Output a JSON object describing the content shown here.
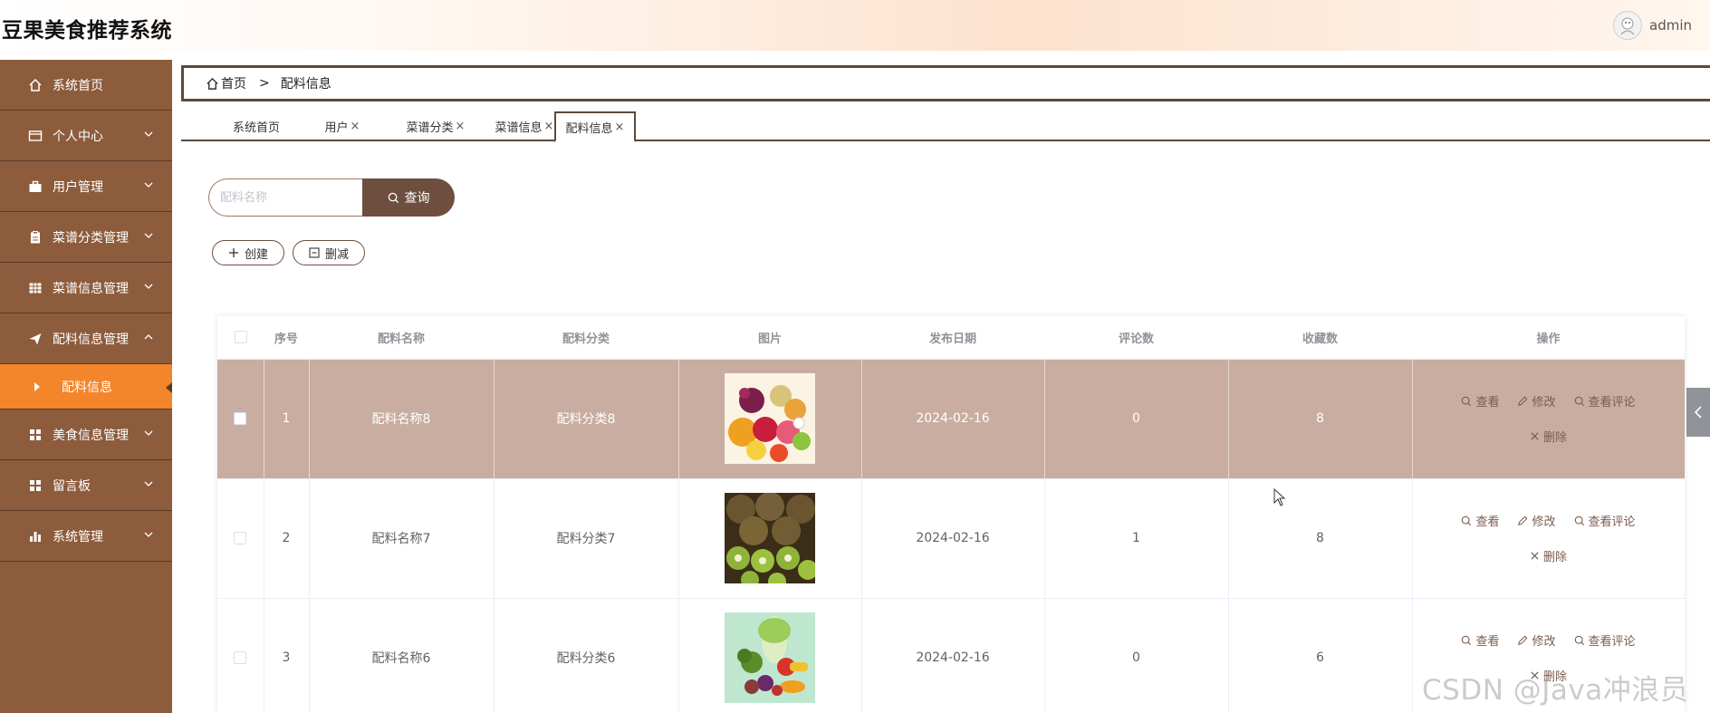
{
  "header": {
    "app_title": "豆果美食推荐系统",
    "username": "admin"
  },
  "sidebar": {
    "items": [
      {
        "label": "系统首页",
        "icon": "home-icon"
      },
      {
        "label": "个人中心",
        "icon": "id-card-icon"
      },
      {
        "label": "用户管理",
        "icon": "briefcase-icon"
      },
      {
        "label": "菜谱分类管理",
        "icon": "clipboard-icon"
      },
      {
        "label": "菜谱信息管理",
        "icon": "grid-icon"
      },
      {
        "label": "配料信息管理",
        "icon": "paper-plane-icon"
      },
      {
        "label": "美食信息管理",
        "icon": "apps-icon"
      },
      {
        "label": "留言板",
        "icon": "apps-icon"
      },
      {
        "label": "系统管理",
        "icon": "bar-chart-icon"
      }
    ],
    "active_sub": "配料信息"
  },
  "breadcrumb": {
    "home": "首页",
    "separator": ">",
    "current": "配料信息"
  },
  "tabs": [
    {
      "label": "系统首页",
      "closable": false
    },
    {
      "label": "用户",
      "closable": true
    },
    {
      "label": "菜谱分类",
      "closable": true
    },
    {
      "label": "菜谱信息",
      "closable": true
    },
    {
      "label": "配料信息",
      "closable": true,
      "active": true
    }
  ],
  "search": {
    "placeholder": "配料名称",
    "button": "查询"
  },
  "actions": {
    "create": "创建",
    "delete": "删减"
  },
  "table": {
    "headers": [
      "序号",
      "配料名称",
      "配料分类",
      "图片",
      "发布日期",
      "评论数",
      "收藏数",
      "操作"
    ],
    "ops": {
      "view": "查看",
      "edit": "修改",
      "comments": "查看评论",
      "delete": "删除"
    },
    "rows": [
      {
        "index": "1",
        "name": "配料名称8",
        "category": "配料分类8",
        "image": "fruit-basket",
        "date": "2024-02-16",
        "comments": "0",
        "favorites": "8"
      },
      {
        "index": "2",
        "name": "配料名称7",
        "category": "配料分类7",
        "image": "kiwi",
        "date": "2024-02-16",
        "comments": "1",
        "favorites": "8"
      },
      {
        "index": "3",
        "name": "配料名称6",
        "category": "配料分类6",
        "image": "vegetables",
        "date": "2024-02-16",
        "comments": "0",
        "favorites": "6"
      }
    ]
  },
  "watermark": "CSDN @Java冲浪员",
  "colors": {
    "sidebar": "#8d5c3c",
    "sidebar_active": "#f3852b",
    "row_highlight": "#c8ada0",
    "button_dark": "#6e4f3f"
  }
}
